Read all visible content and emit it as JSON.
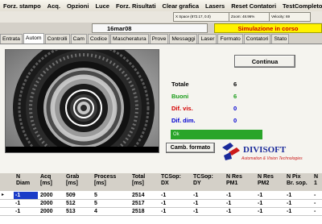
{
  "menu": [
    "Forz. stampo",
    "Acq.",
    "Opzioni",
    "Luce",
    "Forz. Risultati",
    "Clear grafica",
    "Lasers",
    "Reset Contatori",
    "TestCompleto"
  ],
  "info": {
    "space": "X Space  (872.17, 0.0)",
    "zoom": "Zoom: 48.96%",
    "velocity": "Velocity: 69"
  },
  "date": "16mar08",
  "status": "Simulazione in corso",
  "tabs": [
    "Entrata",
    "Autom",
    "Controlli",
    "Cam",
    "Codice",
    "Mascheratura",
    "Prove",
    "Messaggi",
    "Laser",
    "Formato",
    "Contatori",
    "Stato"
  ],
  "active_tab": "Autom",
  "continua_label": "Continua",
  "stats": [
    {
      "label": "Totale",
      "value": "6",
      "label_color": "#000000",
      "value_color": "#000000"
    },
    {
      "label": "Buoni",
      "value": "6",
      "label_color": "#1a9c1a",
      "value_color": "#1a9c1a"
    },
    {
      "label": "Dif. vis.",
      "value": "0",
      "label_color": "#d40000",
      "value_color": "#0000d0"
    },
    {
      "label": "Dif. dim.",
      "value": "0",
      "label_color": "#0000d0",
      "value_color": "#0000d0"
    }
  ],
  "ok_label": "Ok",
  "camb_label": "Camb. formato",
  "logo": {
    "name": "DIVISOFT",
    "tagline": "Automation & Vision Technologies"
  },
  "table": {
    "columns": [
      "N\nDiam",
      "Acq\n[ms]",
      "Grab\n[ms]",
      "Process\n[ms]",
      "Total\n[ms]",
      "TCSop:\nDX",
      "TCSop:\nDY",
      "N Res\nPM1",
      "N Res\nPM2",
      "N Pix\nBr. sop.",
      "N\n1"
    ],
    "rows": [
      [
        "-1",
        "2000",
        "509",
        "5",
        "2514",
        "-1",
        "-1",
        "-1",
        "-1",
        "-1",
        "-"
      ],
      [
        "-1",
        "2000",
        "512",
        "5",
        "2517",
        "-1",
        "-1",
        "-1",
        "-1",
        "-1",
        "-"
      ],
      [
        "-1",
        "2000",
        "513",
        "4",
        "2518",
        "-1",
        "-1",
        "-1",
        "-1",
        "-1",
        "-"
      ]
    ]
  },
  "colors": {
    "sim_bg": "#fff200",
    "sim_text": "#cc0000",
    "ok_bar": "#2aa52a",
    "selected_row": "#1a3cc8"
  }
}
